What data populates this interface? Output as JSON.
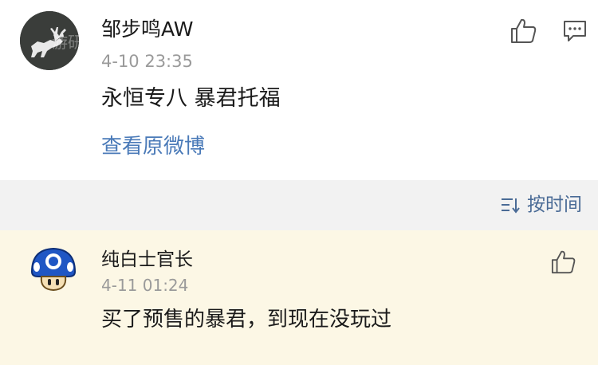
{
  "comments": [
    {
      "username": "邹步鸣AW",
      "time": "4-10 23:35",
      "content": "永恒专八 暴君托福",
      "view_original_link": "查看原微博",
      "avatar_icon": "deer-logo-icon",
      "avatar_watermark": "游研社"
    },
    {
      "username": "纯白士官长",
      "time": "4-11 01:24",
      "content": "买了预售的暴君，到现在没玩过",
      "avatar_icon": "mushroom-avatar-icon"
    }
  ],
  "sort_bar": {
    "label": "按时间",
    "icon": "sort-icon"
  },
  "colors": {
    "link": "#4a7ab8",
    "sort_label": "#4a6b96",
    "highlight_bg": "#fcf7e5",
    "divider_bg": "#f2f2f2",
    "secondary_text": "#9a9a9a"
  }
}
